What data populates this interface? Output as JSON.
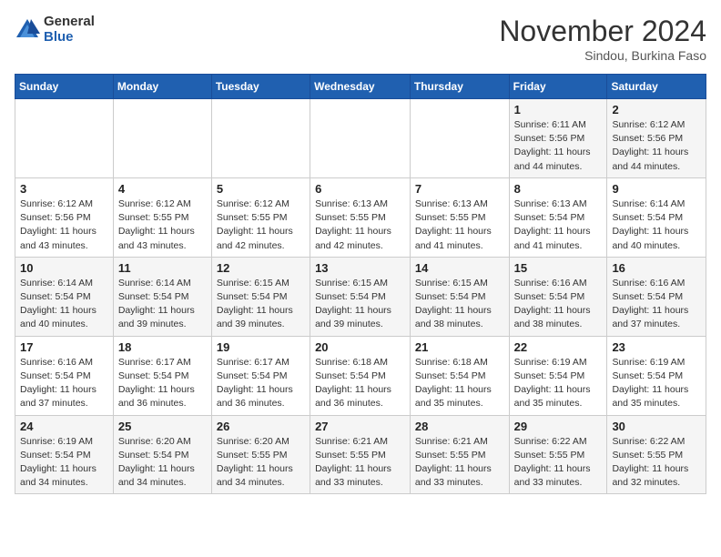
{
  "logo": {
    "general": "General",
    "blue": "Blue"
  },
  "title": "November 2024",
  "location": "Sindou, Burkina Faso",
  "weekdays": [
    "Sunday",
    "Monday",
    "Tuesday",
    "Wednesday",
    "Thursday",
    "Friday",
    "Saturday"
  ],
  "weeks": [
    [
      {
        "day": "",
        "info": ""
      },
      {
        "day": "",
        "info": ""
      },
      {
        "day": "",
        "info": ""
      },
      {
        "day": "",
        "info": ""
      },
      {
        "day": "",
        "info": ""
      },
      {
        "day": "1",
        "info": "Sunrise: 6:11 AM\nSunset: 5:56 PM\nDaylight: 11 hours and 44 minutes."
      },
      {
        "day": "2",
        "info": "Sunrise: 6:12 AM\nSunset: 5:56 PM\nDaylight: 11 hours and 44 minutes."
      }
    ],
    [
      {
        "day": "3",
        "info": "Sunrise: 6:12 AM\nSunset: 5:56 PM\nDaylight: 11 hours and 43 minutes."
      },
      {
        "day": "4",
        "info": "Sunrise: 6:12 AM\nSunset: 5:55 PM\nDaylight: 11 hours and 43 minutes."
      },
      {
        "day": "5",
        "info": "Sunrise: 6:12 AM\nSunset: 5:55 PM\nDaylight: 11 hours and 42 minutes."
      },
      {
        "day": "6",
        "info": "Sunrise: 6:13 AM\nSunset: 5:55 PM\nDaylight: 11 hours and 42 minutes."
      },
      {
        "day": "7",
        "info": "Sunrise: 6:13 AM\nSunset: 5:55 PM\nDaylight: 11 hours and 41 minutes."
      },
      {
        "day": "8",
        "info": "Sunrise: 6:13 AM\nSunset: 5:54 PM\nDaylight: 11 hours and 41 minutes."
      },
      {
        "day": "9",
        "info": "Sunrise: 6:14 AM\nSunset: 5:54 PM\nDaylight: 11 hours and 40 minutes."
      }
    ],
    [
      {
        "day": "10",
        "info": "Sunrise: 6:14 AM\nSunset: 5:54 PM\nDaylight: 11 hours and 40 minutes."
      },
      {
        "day": "11",
        "info": "Sunrise: 6:14 AM\nSunset: 5:54 PM\nDaylight: 11 hours and 39 minutes."
      },
      {
        "day": "12",
        "info": "Sunrise: 6:15 AM\nSunset: 5:54 PM\nDaylight: 11 hours and 39 minutes."
      },
      {
        "day": "13",
        "info": "Sunrise: 6:15 AM\nSunset: 5:54 PM\nDaylight: 11 hours and 39 minutes."
      },
      {
        "day": "14",
        "info": "Sunrise: 6:15 AM\nSunset: 5:54 PM\nDaylight: 11 hours and 38 minutes."
      },
      {
        "day": "15",
        "info": "Sunrise: 6:16 AM\nSunset: 5:54 PM\nDaylight: 11 hours and 38 minutes."
      },
      {
        "day": "16",
        "info": "Sunrise: 6:16 AM\nSunset: 5:54 PM\nDaylight: 11 hours and 37 minutes."
      }
    ],
    [
      {
        "day": "17",
        "info": "Sunrise: 6:16 AM\nSunset: 5:54 PM\nDaylight: 11 hours and 37 minutes."
      },
      {
        "day": "18",
        "info": "Sunrise: 6:17 AM\nSunset: 5:54 PM\nDaylight: 11 hours and 36 minutes."
      },
      {
        "day": "19",
        "info": "Sunrise: 6:17 AM\nSunset: 5:54 PM\nDaylight: 11 hours and 36 minutes."
      },
      {
        "day": "20",
        "info": "Sunrise: 6:18 AM\nSunset: 5:54 PM\nDaylight: 11 hours and 36 minutes."
      },
      {
        "day": "21",
        "info": "Sunrise: 6:18 AM\nSunset: 5:54 PM\nDaylight: 11 hours and 35 minutes."
      },
      {
        "day": "22",
        "info": "Sunrise: 6:19 AM\nSunset: 5:54 PM\nDaylight: 11 hours and 35 minutes."
      },
      {
        "day": "23",
        "info": "Sunrise: 6:19 AM\nSunset: 5:54 PM\nDaylight: 11 hours and 35 minutes."
      }
    ],
    [
      {
        "day": "24",
        "info": "Sunrise: 6:19 AM\nSunset: 5:54 PM\nDaylight: 11 hours and 34 minutes."
      },
      {
        "day": "25",
        "info": "Sunrise: 6:20 AM\nSunset: 5:54 PM\nDaylight: 11 hours and 34 minutes."
      },
      {
        "day": "26",
        "info": "Sunrise: 6:20 AM\nSunset: 5:55 PM\nDaylight: 11 hours and 34 minutes."
      },
      {
        "day": "27",
        "info": "Sunrise: 6:21 AM\nSunset: 5:55 PM\nDaylight: 11 hours and 33 minutes."
      },
      {
        "day": "28",
        "info": "Sunrise: 6:21 AM\nSunset: 5:55 PM\nDaylight: 11 hours and 33 minutes."
      },
      {
        "day": "29",
        "info": "Sunrise: 6:22 AM\nSunset: 5:55 PM\nDaylight: 11 hours and 33 minutes."
      },
      {
        "day": "30",
        "info": "Sunrise: 6:22 AM\nSunset: 5:55 PM\nDaylight: 11 hours and 32 minutes."
      }
    ]
  ]
}
